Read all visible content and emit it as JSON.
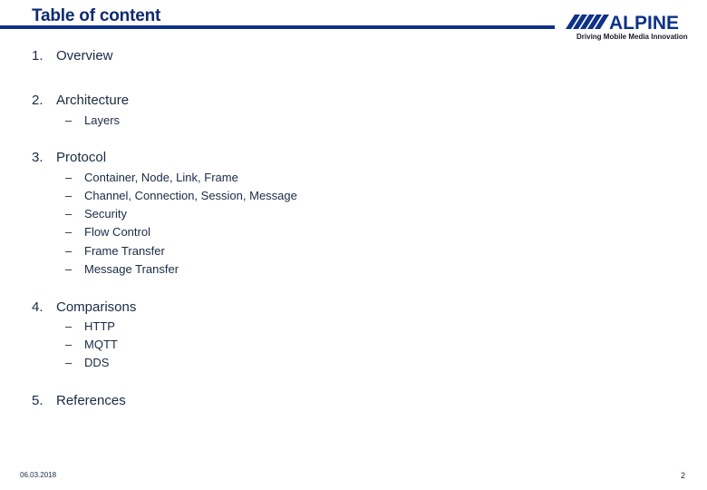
{
  "header": {
    "title": "Table of content",
    "logo_text": "ALPINE",
    "tagline": "Driving Mobile Media Innovation",
    "accent_color": "#0e3288"
  },
  "toc": [
    {
      "number": "1.",
      "label": "Overview",
      "subitems": []
    },
    {
      "number": "2.",
      "label": "Architecture",
      "subitems": [
        "Layers"
      ]
    },
    {
      "number": "3.",
      "label": "Protocol",
      "subitems": [
        "Container, Node, Link, Frame",
        "Channel, Connection, Session, Message",
        "Security",
        "Flow Control",
        "Frame Transfer",
        "Message Transfer"
      ]
    },
    {
      "number": "4.",
      "label": "Comparisons",
      "subitems": [
        "HTTP",
        "MQTT",
        "DDS"
      ]
    },
    {
      "number": "5.",
      "label": "References",
      "subitems": []
    }
  ],
  "dash": "–",
  "footer": {
    "date": "06.03.2018",
    "page_number": "2"
  }
}
